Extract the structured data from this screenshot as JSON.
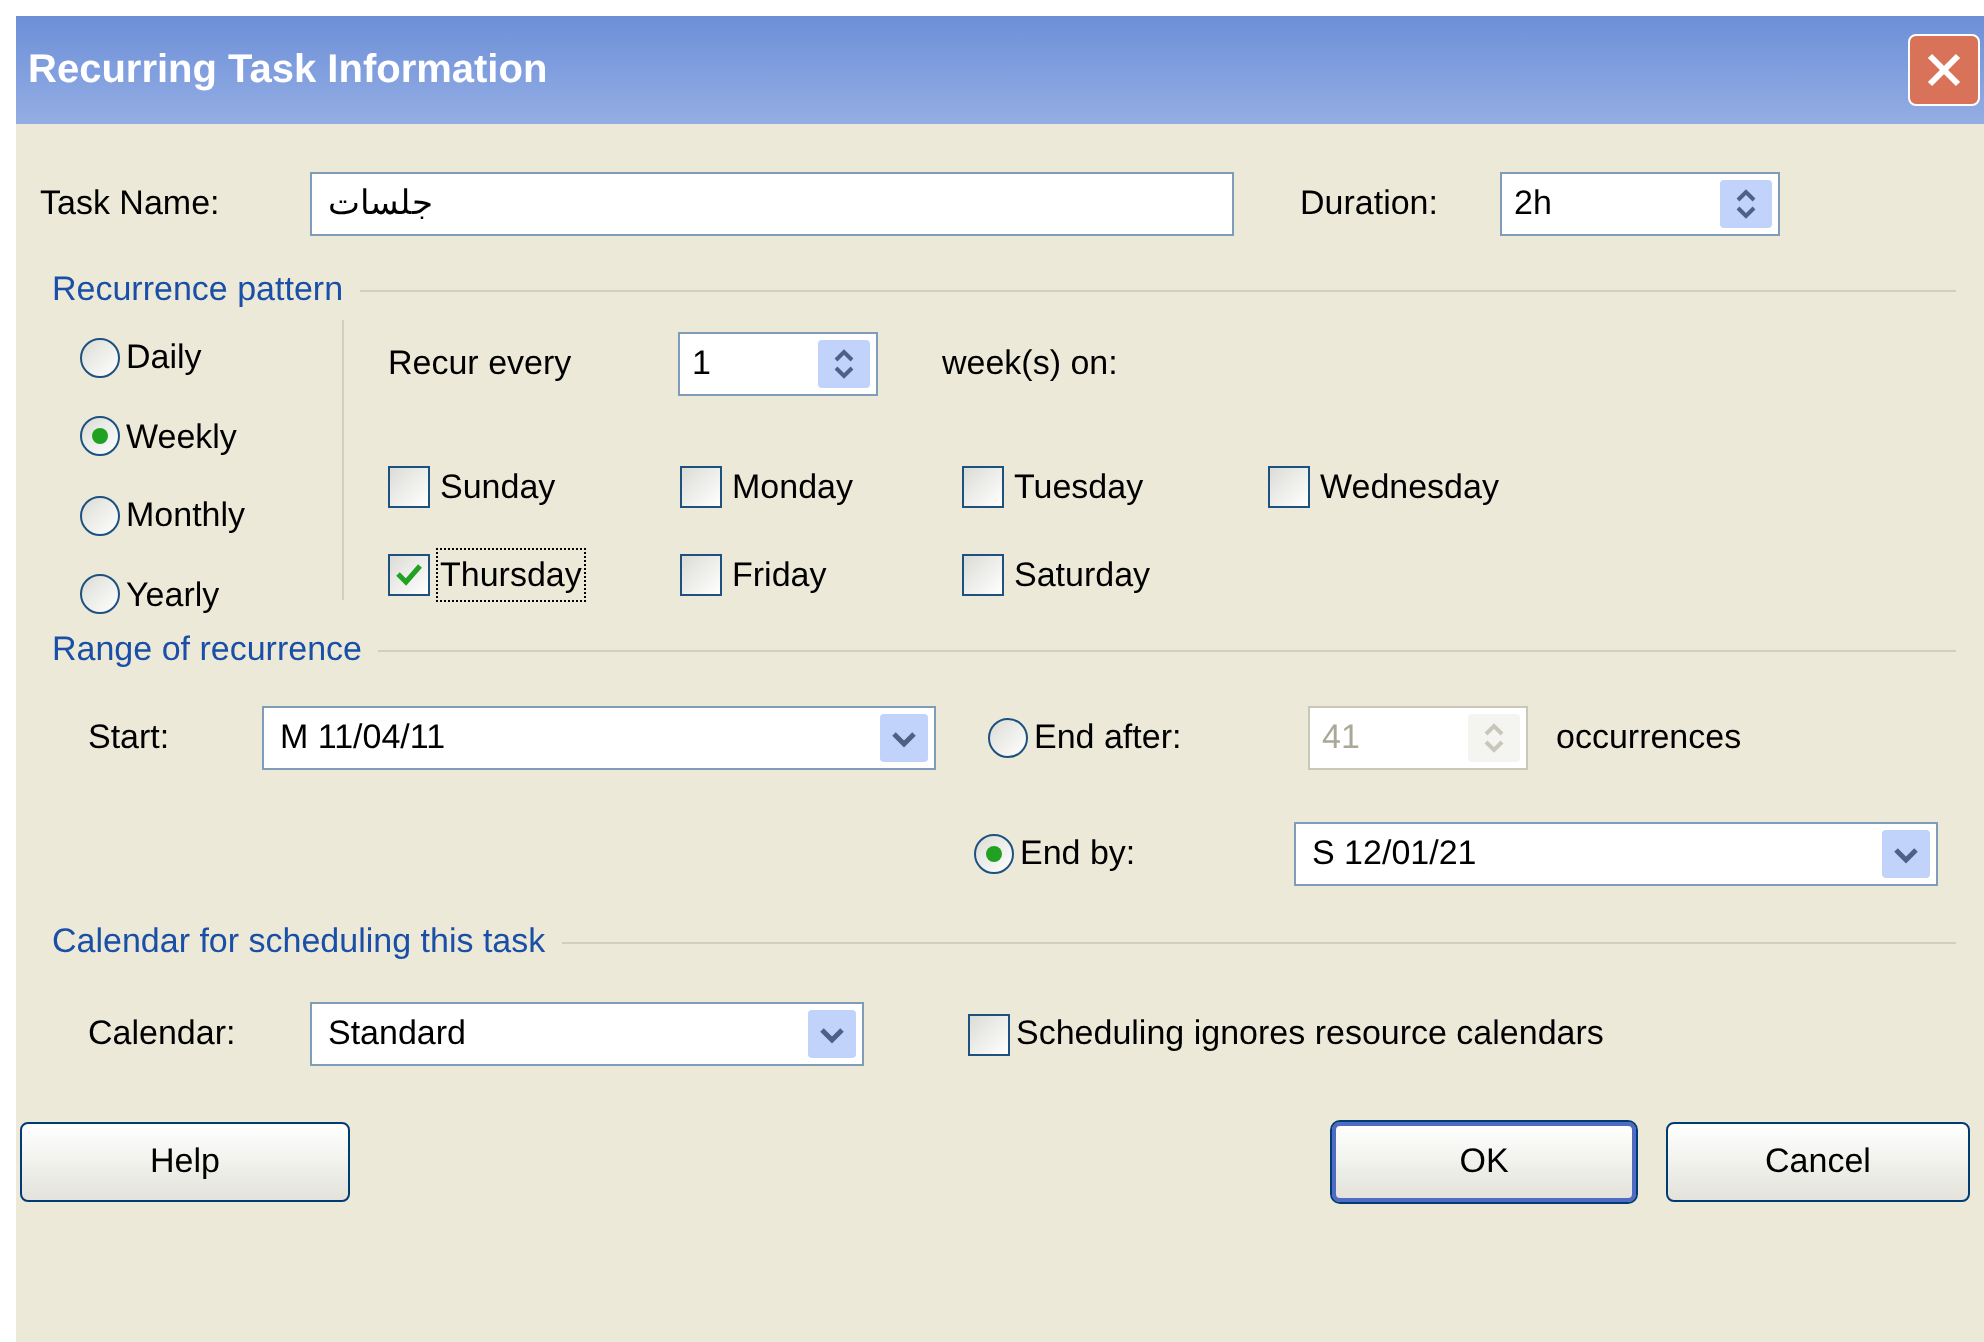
{
  "window": {
    "title": "Recurring Task Information"
  },
  "task_name": {
    "label": "Task Name:",
    "value": "جلسات"
  },
  "duration": {
    "label": "Duration:",
    "value": "2h"
  },
  "recurrence_pattern": {
    "heading": "Recurrence pattern",
    "frequencies": [
      {
        "label": "Daily",
        "selected": false
      },
      {
        "label": "Weekly",
        "selected": true
      },
      {
        "label": "Monthly",
        "selected": false
      },
      {
        "label": "Yearly",
        "selected": false
      }
    ],
    "recur_every": {
      "label": "Recur every",
      "value": "1",
      "unit": "week(s) on:"
    },
    "days": [
      {
        "label": "Sunday",
        "checked": false,
        "focused": false
      },
      {
        "label": "Monday",
        "checked": false,
        "focused": false
      },
      {
        "label": "Tuesday",
        "checked": false,
        "focused": false
      },
      {
        "label": "Wednesday",
        "checked": false,
        "focused": false
      },
      {
        "label": "Thursday",
        "checked": true,
        "focused": true
      },
      {
        "label": "Friday",
        "checked": false,
        "focused": false
      },
      {
        "label": "Saturday",
        "checked": false,
        "focused": false
      }
    ]
  },
  "range_of_recurrence": {
    "heading": "Range of recurrence",
    "start": {
      "label": "Start:",
      "value": "M 11/04/11"
    },
    "end_after": {
      "label": "End after:",
      "selected": false,
      "disabled": true,
      "value": "41",
      "unit": "occurrences"
    },
    "end_by": {
      "label": "End by:",
      "selected": true,
      "value": "S 12/01/21"
    }
  },
  "calendar_section": {
    "heading": "Calendar for scheduling this task",
    "calendar": {
      "label": "Calendar:",
      "value": "Standard"
    },
    "ignore_resource_calendars": {
      "label": "Scheduling ignores resource calendars",
      "checked": false
    }
  },
  "buttons": [
    {
      "label": "Help",
      "default": false
    },
    {
      "label": "OK",
      "default": true
    },
    {
      "label": "Cancel",
      "default": false
    }
  ]
}
